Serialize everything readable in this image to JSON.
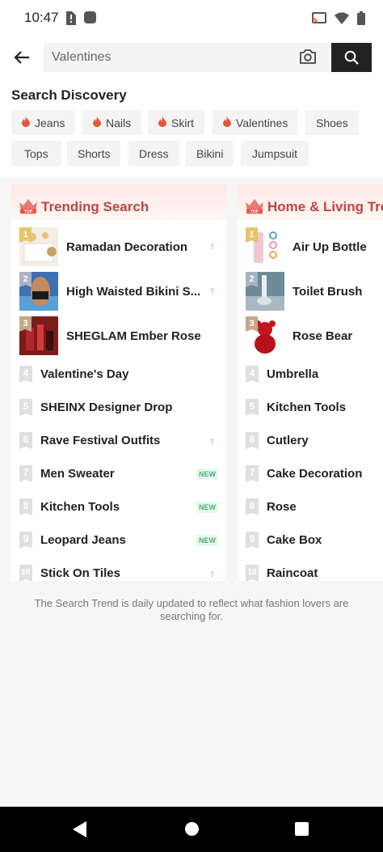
{
  "status": {
    "time": "10:47"
  },
  "search": {
    "value": "Valentines"
  },
  "discovery": {
    "title": "Search Discovery",
    "chips_row1": [
      {
        "label": "Jeans",
        "hot": true
      },
      {
        "label": "Nails",
        "hot": true
      },
      {
        "label": "Skirt",
        "hot": true
      },
      {
        "label": "Valentines",
        "hot": true
      },
      {
        "label": "Shoes",
        "hot": false
      }
    ],
    "chips_row2": [
      {
        "label": "Tops",
        "hot": false
      },
      {
        "label": "Shorts",
        "hot": false
      },
      {
        "label": "Dress",
        "hot": false
      },
      {
        "label": "Bikini",
        "hot": false
      },
      {
        "label": "Jumpsuit",
        "hot": false
      }
    ]
  },
  "trending": {
    "title": "Trending Search",
    "items": [
      {
        "rank": "1",
        "label": "Ramadan Decoration",
        "tag": "up"
      },
      {
        "rank": "2",
        "label": "High Waisted Bikini S...",
        "tag": "up"
      },
      {
        "rank": "3",
        "label": "SHEGLAM Ember Rose",
        "tag": ""
      },
      {
        "rank": "4",
        "label": "Valentine's Day",
        "tag": ""
      },
      {
        "rank": "5",
        "label": "SHEINX Designer Drop",
        "tag": ""
      },
      {
        "rank": "6",
        "label": "Rave Festival Outfits",
        "tag": "up"
      },
      {
        "rank": "7",
        "label": "Men Sweater",
        "tag": "new"
      },
      {
        "rank": "8",
        "label": "Kitchen Tools",
        "tag": "new"
      },
      {
        "rank": "9",
        "label": "Leopard Jeans",
        "tag": "new"
      },
      {
        "rank": "10",
        "label": "Stick On Tiles",
        "tag": "up"
      }
    ]
  },
  "home_living": {
    "title": "Home & Living Trends",
    "items": [
      {
        "rank": "1",
        "label": "Air Up Bottle"
      },
      {
        "rank": "2",
        "label": "Toilet Brush"
      },
      {
        "rank": "3",
        "label": "Rose Bear"
      },
      {
        "rank": "4",
        "label": "Umbrella"
      },
      {
        "rank": "5",
        "label": "Kitchen Tools"
      },
      {
        "rank": "6",
        "label": "Cutlery"
      },
      {
        "rank": "7",
        "label": "Cake Decoration"
      },
      {
        "rank": "8",
        "label": "Rose"
      },
      {
        "rank": "9",
        "label": "Cake Box"
      },
      {
        "rank": "10",
        "label": "Raincoat"
      }
    ]
  },
  "tags": {
    "new_label": "NEW"
  },
  "footnote": "The Search Trend is daily updated to reflect what fashion lovers are searching for.",
  "colors": {
    "accent": "#c0463f",
    "fire": "#e8553a",
    "new": "#4caf78",
    "rank1": "#e8c46a",
    "rank2": "#a9b3c4",
    "rank3": "#c9a58a"
  }
}
